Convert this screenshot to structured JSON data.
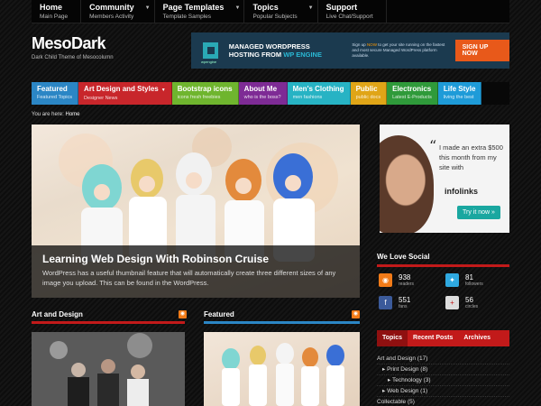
{
  "topnav": [
    {
      "title": "Home",
      "sub": "Main Page",
      "dropdown": false
    },
    {
      "title": "Community",
      "sub": "Members Activity",
      "dropdown": true
    },
    {
      "title": "Page Templates",
      "sub": "Template Samples",
      "dropdown": true
    },
    {
      "title": "Topics",
      "sub": "Popular Subjects",
      "dropdown": true
    },
    {
      "title": "Support",
      "sub": "Live Chat/Support",
      "dropdown": false
    }
  ],
  "site": {
    "logo": "MesoDark",
    "tagline": "Dark Child Theme of Mesocolumn"
  },
  "header_ad": {
    "headline_1": "MANAGED WORDPRESS",
    "headline_2": "HOSTING FROM",
    "headline_hl": "WP ENGINE",
    "brand": "wpengine",
    "copy_1": "Sign up",
    "copy_hl": "NOW",
    "copy_2": "to get your site running on the fastest and most secure Managed WordPress platform available.",
    "button": "SIGN UP NOW"
  },
  "categories": [
    {
      "title": "Featured",
      "sub": "Featured Topics",
      "color": "#2b86c5",
      "dropdown": false
    },
    {
      "title": "Art Design and Styles",
      "sub": "Designer News",
      "color": "#c8262b",
      "dropdown": true
    },
    {
      "title": "Bootstrap icons",
      "sub": "icons fresh freebies",
      "color": "#6fb52e",
      "dropdown": false
    },
    {
      "title": "About Me",
      "sub": "who is the boss?",
      "color": "#7e2b95",
      "dropdown": false
    },
    {
      "title": "Men's Clothing",
      "sub": "men fashions",
      "color": "#27b3c4",
      "dropdown": false
    },
    {
      "title": "Public",
      "sub": "public docs",
      "color": "#e0a517",
      "dropdown": false
    },
    {
      "title": "Electronics",
      "sub": "Latest E-Products",
      "color": "#2f9a3a",
      "dropdown": false
    },
    {
      "title": "Life Style",
      "sub": "living the best",
      "color": "#1e9bd8",
      "dropdown": false
    }
  ],
  "breadcrumb": {
    "prefix": "You are here:",
    "current": "Home"
  },
  "hero": {
    "title": "Learning Web Design With Robinson Cruise",
    "description": "WordPress has a useful thumbnail feature that will automatically create three different sizes of any image you upload. This can be found in the WordPress."
  },
  "side_ad": {
    "quote": "I made an extra $500 this month from my site with",
    "brand": "infolinks",
    "button": "Try it now »"
  },
  "social": {
    "heading": "We Love Social",
    "items": [
      {
        "icon": "rss-icon",
        "count": "938",
        "label": "readers",
        "color": "#f27b18",
        "glyph": "◉"
      },
      {
        "icon": "twitter-icon",
        "count": "81",
        "label": "followers",
        "color": "#2fa9e0",
        "glyph": "✦"
      },
      {
        "icon": "facebook-icon",
        "count": "551",
        "label": "fans",
        "color": "#3b5a9a",
        "glyph": "f"
      },
      {
        "icon": "google-plus-icon",
        "count": "56",
        "label": "circles",
        "color": "#dddddd",
        "glyph": "+"
      }
    ]
  },
  "sections": {
    "art": "Art and Design",
    "featured": "Featured"
  },
  "tabs": {
    "items": [
      "Topics",
      "Recent Posts",
      "Archives"
    ],
    "active": 0
  },
  "topics": [
    {
      "label": "Art and Design (17)",
      "indent": 0
    },
    {
      "label": "Print Design (8)",
      "indent": 1
    },
    {
      "label": "Technology (3)",
      "indent": 2
    },
    {
      "label": "Web Design (1)",
      "indent": 1
    },
    {
      "label": "Collectable (5)",
      "indent": 0
    }
  ]
}
